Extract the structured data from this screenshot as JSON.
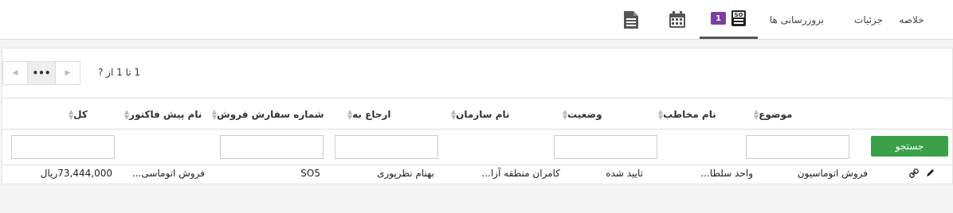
{
  "tabs": [
    {
      "label": "خلاصه"
    },
    {
      "label": "جزئیات"
    },
    {
      "label": "بروزرسانی ها"
    },
    {
      "label": "",
      "icon": "so-document-icon",
      "badge": "1",
      "active": true
    },
    {
      "label": "",
      "icon": "calendar-icon"
    },
    {
      "label": "",
      "icon": "file-icon"
    }
  ],
  "pager": {
    "more_label": "•••",
    "info": "1 تا 1 از ?"
  },
  "columns": [
    {
      "label": "موضوع"
    },
    {
      "label": "نام مخاطب"
    },
    {
      "label": "وضعیت"
    },
    {
      "label": "نام سازمان"
    },
    {
      "label": "ارجاع به"
    },
    {
      "label": "شماره سفارش فروش"
    },
    {
      "label": "نام پیش فاکتور"
    },
    {
      "label": "کل"
    }
  ],
  "search_label": "جستجو",
  "rows": [
    {
      "subject": "فروش اتوماسیون",
      "contact": "واحد سلطا...",
      "status": "تایید شده",
      "organization": "کامران منطقه آزا...",
      "assigned_to": "بهنام نظرپوری",
      "so_number": "SO5",
      "quote_name": "فروش اتوماسی...",
      "total": "73,444,000ریال"
    }
  ],
  "colors": {
    "accent": "#3aa14a",
    "badge": "#7b3f9e"
  }
}
